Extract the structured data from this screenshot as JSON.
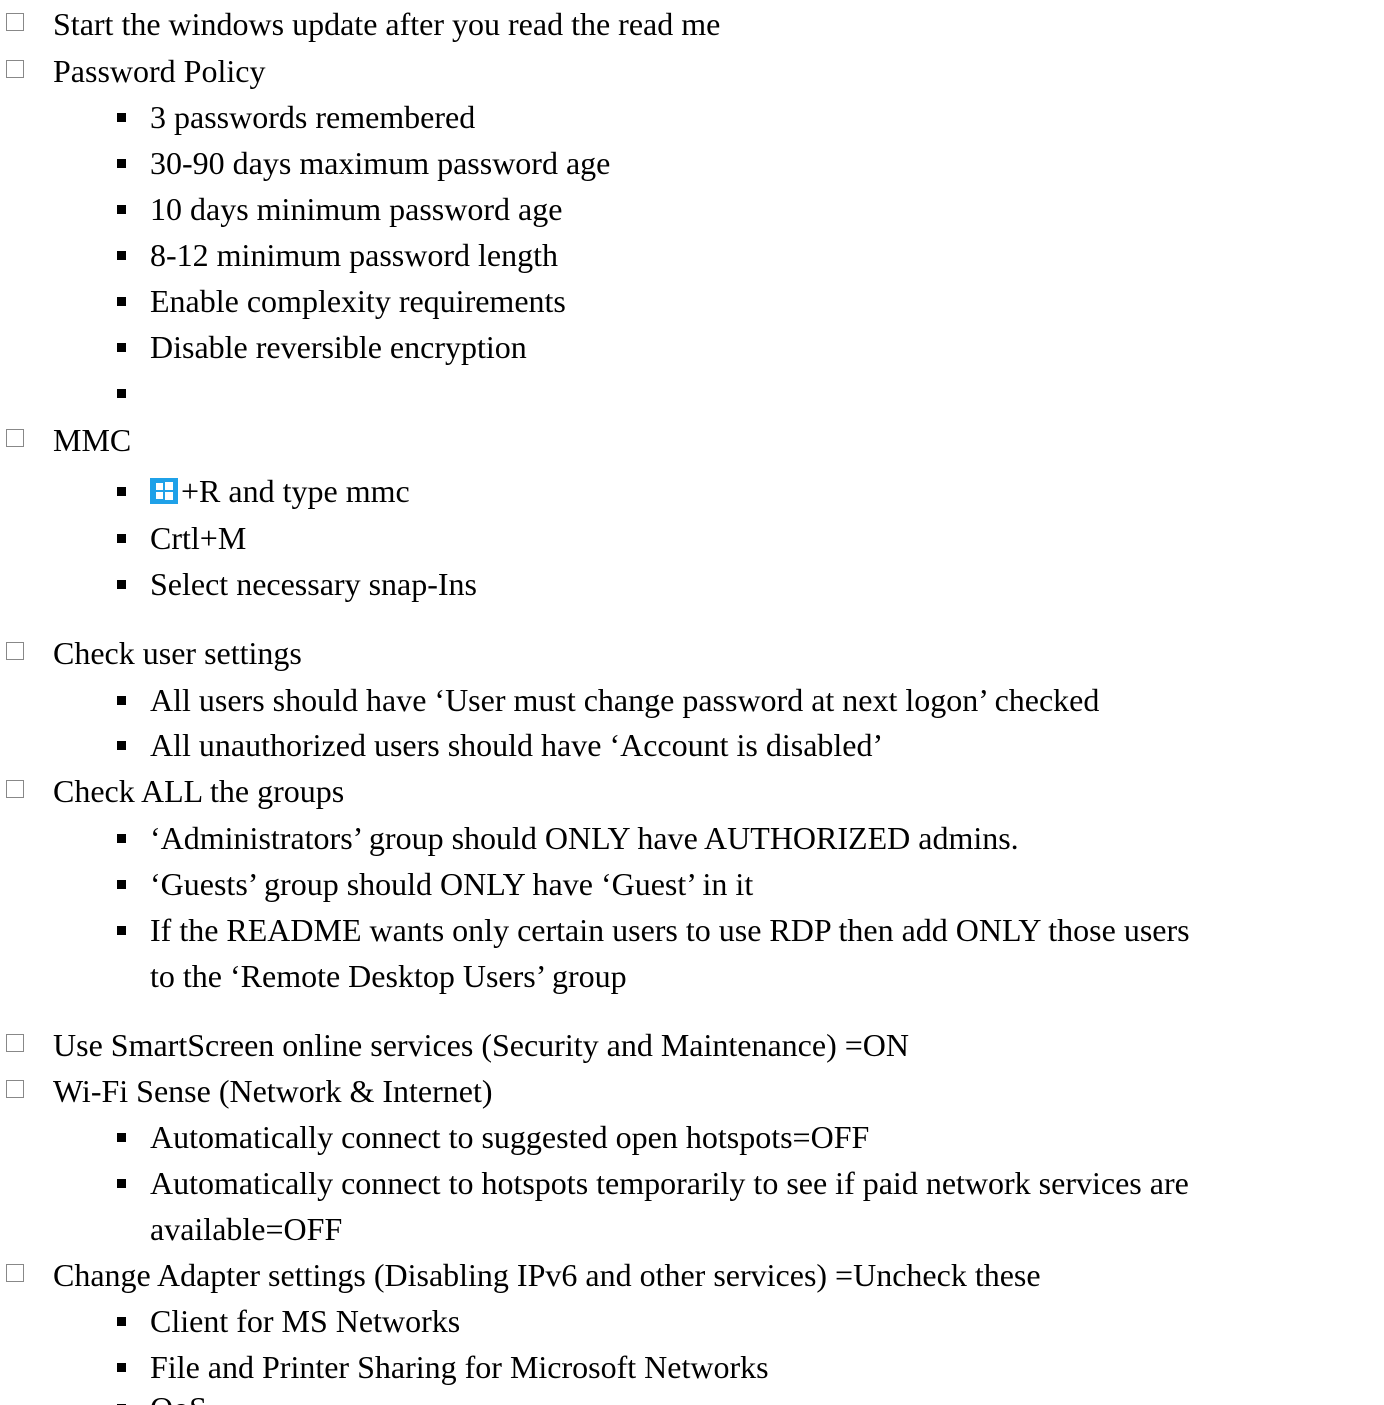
{
  "items": {
    "i0": "Start the windows update after you read the read me",
    "i1": "Password Policy",
    "i1s0": "3 passwords remembered",
    "i1s1": "30-90 days maximum password age",
    "i1s2": "10 days minimum password age",
    "i1s3": "8-12 minimum password length",
    "i1s4": "Enable complexity requirements",
    "i1s5": "Disable reversible encryption",
    "i2": "MMC",
    "i2s0": "+R and type mmc",
    "i2s1": "Crtl+M",
    "i2s2": "Select necessary snap-Ins",
    "i3": "Check user settings",
    "i3s0": "All users should have ‘User must change password at next logon’ checked",
    "i3s1": "All unauthorized users should have ‘Account is disabled’",
    "i4": "Check ALL the groups",
    "i4s0": "‘Administrators’ group should ONLY have AUTHORIZED admins.",
    "i4s1": "‘Guests’ group should ONLY have ‘Guest’ in it",
    "i4s2a": "If the README wants only certain users to use RDP then add ONLY those users",
    "i4s2b": "to the ‘Remote Desktop Users’ group",
    "i5": "Use SmartScreen online services (Security and Maintenance) =ON",
    "i6": "Wi-Fi Sense (Network & Internet)",
    "i6s0": "Automatically connect to suggested open hotspots=OFF",
    "i6s1a": "Automatically connect to hotspots temporarily to see if paid network services are",
    "i6s1b": "available=OFF",
    "i7": "Change Adapter settings (Disabling IPv6 and other services) =Uncheck these",
    "i7s0": "Client for MS Networks",
    "i7s1": "File and Printer Sharing for Microsoft Networks",
    "i7s2": "QoS"
  },
  "colors": {
    "checkbox_border": "#888888",
    "windows_logo": "#1fa1e8"
  },
  "icons": {
    "windows_key": "windows-logo-icon"
  }
}
